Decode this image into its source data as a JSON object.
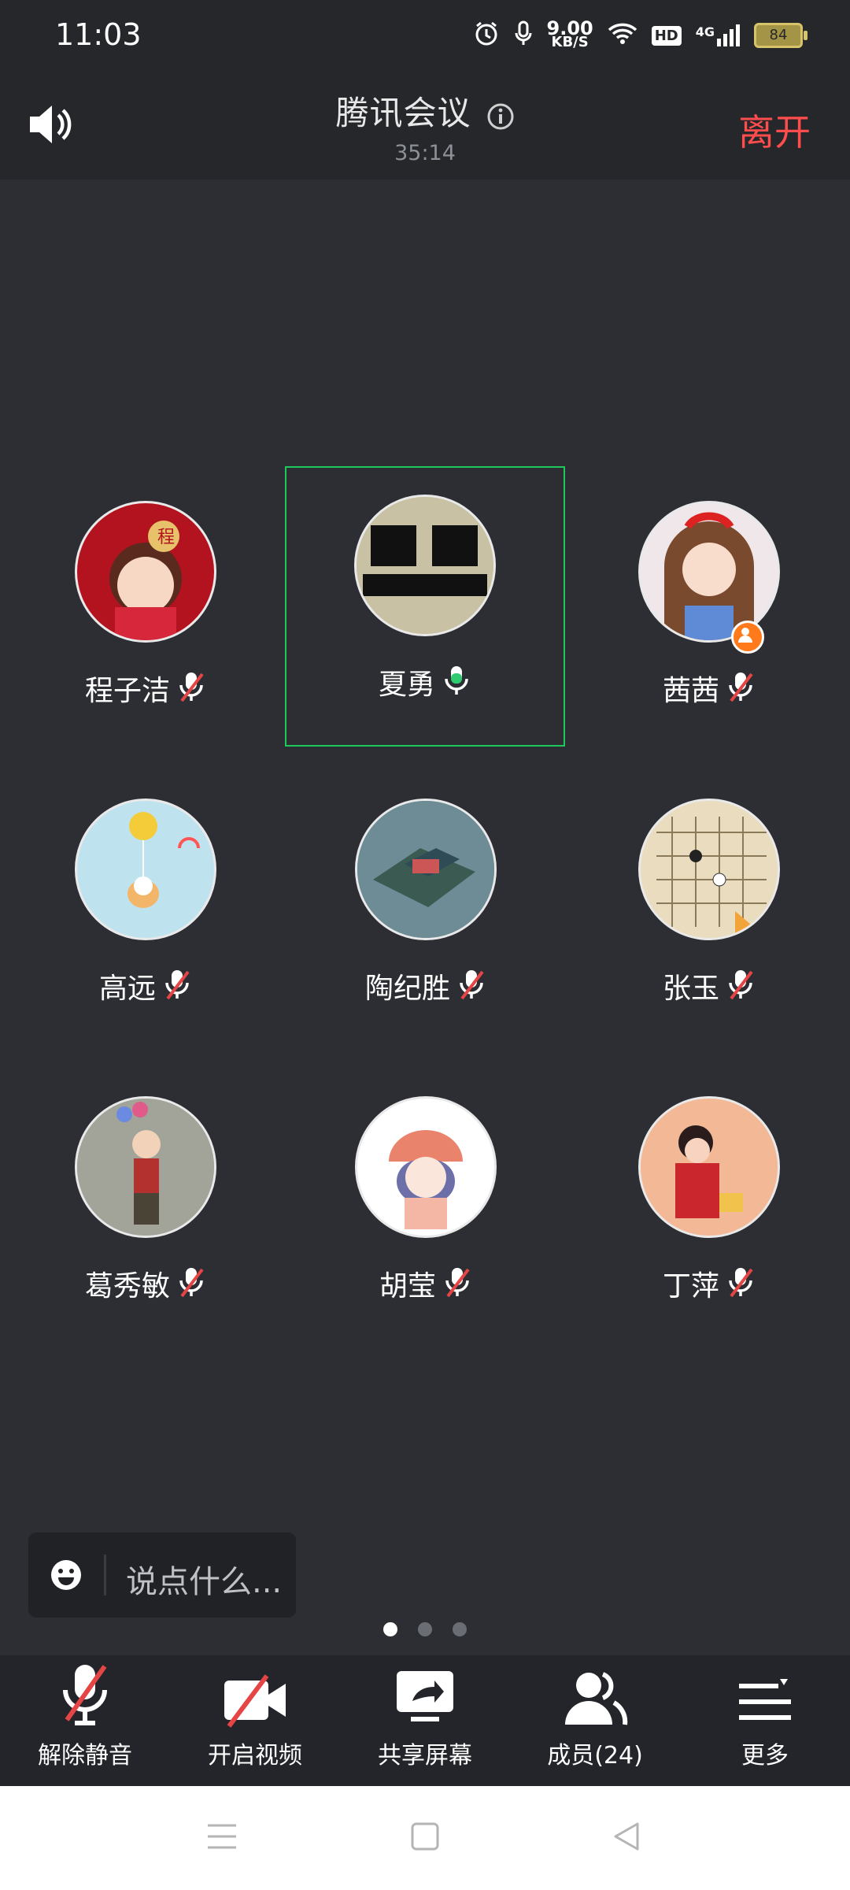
{
  "status_bar": {
    "time": "11:03",
    "net_speed_value": "9.00",
    "net_speed_unit": "KB/S",
    "hd_label": "HD",
    "network_type": "4G",
    "battery_level": "84"
  },
  "header": {
    "title": "腾讯会议",
    "timer": "35:14",
    "leave_label": "离开"
  },
  "participants": [
    {
      "name": "程子洁",
      "mic": "muted",
      "avatar_color": "#b3131e"
    },
    {
      "name": "夏勇",
      "mic": "active",
      "avatar_color": "#c8c1a4",
      "speaking": true
    },
    {
      "name": "茜茜",
      "mic": "muted",
      "avatar_color": "#efe7e9",
      "host_badge": true
    },
    {
      "name": "高远",
      "mic": "muted",
      "avatar_color": "#bfe3ee"
    },
    {
      "name": "陶纪胜",
      "mic": "muted",
      "avatar_color": "#4f6f7a"
    },
    {
      "name": "张玉",
      "mic": "muted",
      "avatar_color": "#e8d7b8"
    },
    {
      "name": "葛秀敏",
      "mic": "muted",
      "avatar_color": "#9b9c94"
    },
    {
      "name": "胡莹",
      "mic": "muted",
      "avatar_color": "#ffffff"
    },
    {
      "name": "丁萍",
      "mic": "muted",
      "avatar_color": "#f3b996"
    }
  ],
  "chat": {
    "placeholder": "说点什么..."
  },
  "pager": {
    "pages": 3,
    "current": 1
  },
  "toolbar": {
    "unmute_label": "解除静音",
    "video_label": "开启视频",
    "share_label": "共享屏幕",
    "members_label": "成员(24)",
    "more_label": "更多"
  },
  "colors": {
    "leave": "#ff4d4d",
    "speaking_border": "#1ec85b",
    "mute_slash": "#e54545",
    "active_mic": "#2ecc71"
  }
}
